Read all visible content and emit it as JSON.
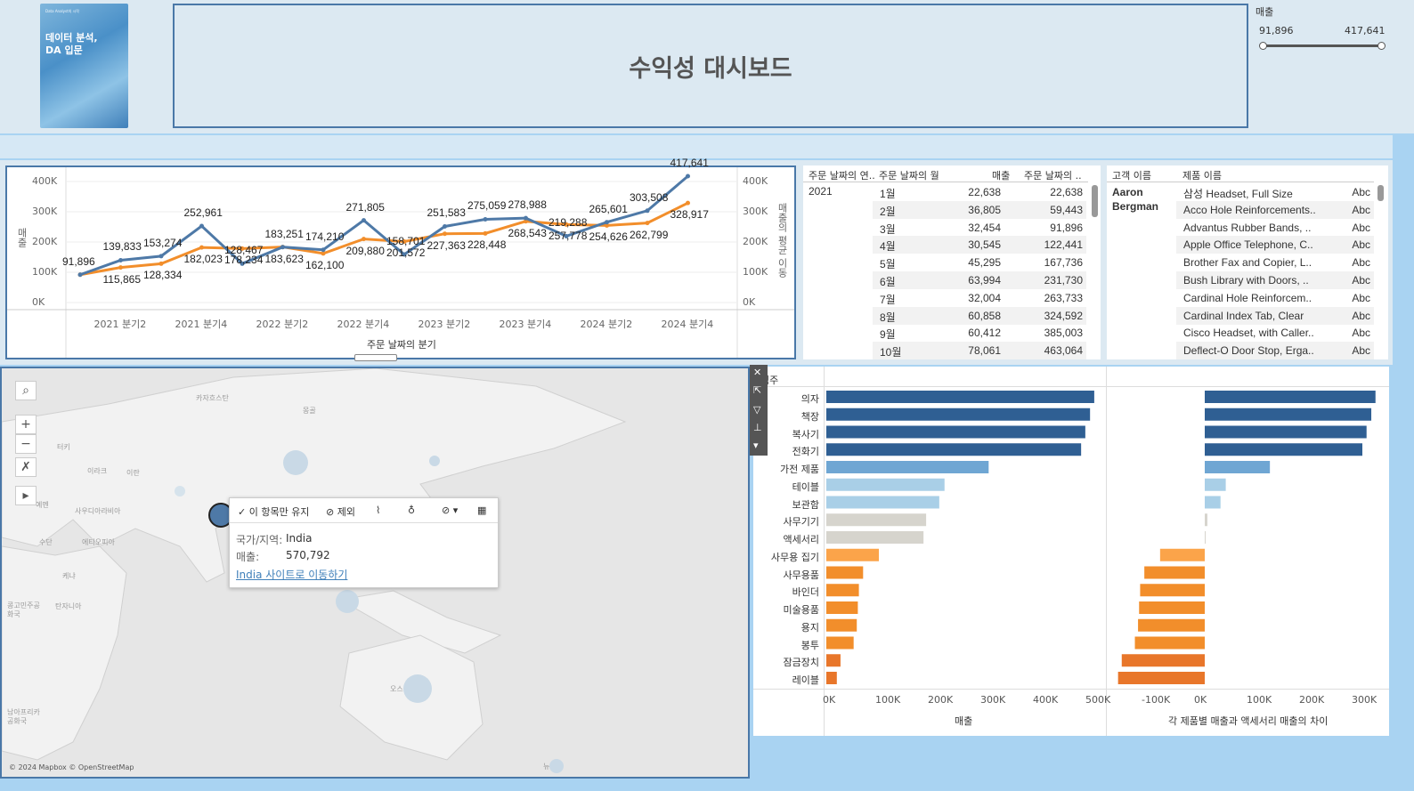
{
  "header": {
    "title": "수익성 대시보드",
    "book_title": "데이터 분석,\nDA 입문",
    "book_subtitle": "Data Analyst의 시작",
    "slider": {
      "label": "매출",
      "min": "91,896",
      "max": "417,641"
    }
  },
  "line_chart": {
    "y_left_label": "매출",
    "y_right_label": "매출의 평균 이동",
    "x_label": "주문 날짜의 분기",
    "y_ticks": [
      "400K",
      "300K",
      "200K",
      "100K",
      "0K"
    ],
    "x_ticks": [
      "2021 분기2",
      "2021 분기4",
      "2022 분기2",
      "2022 분기4",
      "2023 분기2",
      "2023 분기4",
      "2024 분기2",
      "2024 분기4"
    ]
  },
  "chart_data": [
    {
      "type": "line",
      "title": "",
      "xlabel": "주문 날짜의 분기",
      "ylabel": "매출",
      "ylim": [
        0,
        450000
      ],
      "x": [
        "2021 Q1",
        "2021 Q2",
        "2021 Q3",
        "2021 Q4",
        "2022 Q1",
        "2022 Q2",
        "2022 Q3",
        "2022 Q4",
        "2023 Q1",
        "2023 Q2",
        "2023 Q3",
        "2023 Q4",
        "2024 Q1",
        "2024 Q2",
        "2024 Q3",
        "2024 Q4"
      ],
      "series": [
        {
          "name": "매출",
          "color": "#4e79a7",
          "values": [
            91896,
            139833,
            153274,
            252961,
            128467,
            183251,
            174210,
            271805,
            158701,
            251583,
            275059,
            278988,
            219288,
            265601,
            303508,
            417641
          ]
        },
        {
          "name": "매출의 평균 이동",
          "color": "#f28e2b",
          "values": [
            91896,
            115865,
            128334,
            182023,
            178234,
            183623,
            162100,
            209880,
            201572,
            227363,
            228448,
            268543,
            257778,
            254626,
            262799,
            328917
          ]
        }
      ],
      "labels": [
        {
          "t": "91,896",
          "i": 0,
          "s": 0
        },
        {
          "t": "139,833",
          "i": 1,
          "s": 0
        },
        {
          "t": "115,865",
          "i": 1,
          "s": 1
        },
        {
          "t": "128,334",
          "i": 2,
          "s": 1
        },
        {
          "t": "153,274",
          "i": 2,
          "s": 0
        },
        {
          "t": "252,961",
          "i": 3,
          "s": 0
        },
        {
          "t": "182,023",
          "i": 3,
          "s": 1
        },
        {
          "t": "178,234",
          "i": 4,
          "s": 1
        },
        {
          "t": "128,467",
          "i": 4,
          "s": 0
        },
        {
          "t": "183,251",
          "i": 5,
          "s": 0
        },
        {
          "t": "183,623",
          "i": 5,
          "s": 1
        },
        {
          "t": "174,210",
          "i": 6,
          "s": 0
        },
        {
          "t": "162,100",
          "i": 6,
          "s": 1
        },
        {
          "t": "271,805",
          "i": 7,
          "s": 0
        },
        {
          "t": "209,880",
          "i": 7,
          "s": 1
        },
        {
          "t": "201,572",
          "i": 8,
          "s": 1
        },
        {
          "t": "158,701",
          "i": 8,
          "s": 0
        },
        {
          "t": "251,583",
          "i": 9,
          "s": 0
        },
        {
          "t": "227,363",
          "i": 9,
          "s": 1
        },
        {
          "t": "275,059",
          "i": 10,
          "s": 0
        },
        {
          "t": "228,448",
          "i": 10,
          "s": 1
        },
        {
          "t": "278,988",
          "i": 11,
          "s": 0
        },
        {
          "t": "268,543",
          "i": 11,
          "s": 1
        },
        {
          "t": "257,778",
          "i": 12,
          "s": 1
        },
        {
          "t": "219,288",
          "i": 12,
          "s": 0
        },
        {
          "t": "265,601",
          "i": 13,
          "s": 0
        },
        {
          "t": "254,626",
          "i": 13,
          "s": 1
        },
        {
          "t": "303,508",
          "i": 14,
          "s": 0
        },
        {
          "t": "262,799",
          "i": 14,
          "s": 1
        },
        {
          "t": "417,641",
          "i": 15,
          "s": 0
        },
        {
          "t": "328,917",
          "i": 15,
          "s": 1
        }
      ]
    },
    {
      "type": "bar",
      "xlabel": "매출",
      "x_ticks": [
        "0K",
        "100K",
        "200K",
        "300K",
        "400K",
        "500K"
      ],
      "categories": [
        "의자",
        "책장",
        "복사기",
        "전화기",
        "가전 제품",
        "테이블",
        "보관함",
        "사무기기",
        "액세서리",
        "사무용 집기",
        "사무용품",
        "바인더",
        "미술용품",
        "용지",
        "봉투",
        "잠금장치",
        "레이블"
      ],
      "values": [
        510000,
        502000,
        493000,
        485000,
        309000,
        225000,
        215000,
        190000,
        185000,
        100000,
        70000,
        62000,
        60000,
        58000,
        52000,
        27000,
        20000
      ]
    },
    {
      "type": "bar",
      "xlabel": "각 제품별 매출과 액세서리 매출의 차이",
      "x_ticks": [
        "-100K",
        "0K",
        "100K",
        "200K",
        "300K"
      ],
      "categories": [
        "의자",
        "책장",
        "복사기",
        "전화기",
        "가전 제품",
        "테이블",
        "보관함",
        "사무기기",
        "액세서리",
        "사무용 집기",
        "사무용품",
        "바인더",
        "미술용품",
        "용지",
        "봉투",
        "잠금장치",
        "레이블"
      ],
      "values": [
        325000,
        317000,
        308000,
        300000,
        124000,
        40000,
        30000,
        5000,
        0,
        -85000,
        -115000,
        -123000,
        -125000,
        -127000,
        -133000,
        -158000,
        -165000
      ]
    }
  ],
  "bar_chart": {
    "header": "범주",
    "legend": {
      "dark": "#2f5f93",
      "mid": "#6fa6d3",
      "light": "#a9cfe7",
      "gray": "#d6d4cd",
      "orange_light": "#fba44a",
      "orange": "#f28e2b",
      "orange_dark": "#e8762a"
    }
  },
  "table1": {
    "headers": [
      "주문 날짜의 연..",
      "주문 날짜의 월",
      "매출",
      "주문 날짜의 .."
    ],
    "year": "2021",
    "rows": [
      [
        "1월",
        "22,638",
        "22,638"
      ],
      [
        "2월",
        "36,805",
        "59,443"
      ],
      [
        "3월",
        "32,454",
        "91,896"
      ],
      [
        "4월",
        "30,545",
        "122,441"
      ],
      [
        "5월",
        "45,295",
        "167,736"
      ],
      [
        "6월",
        "63,994",
        "231,730"
      ],
      [
        "7월",
        "32,004",
        "263,733"
      ],
      [
        "8월",
        "60,858",
        "324,592"
      ],
      [
        "9월",
        "60,412",
        "385,003"
      ],
      [
        "10월",
        "78,061",
        "463,064"
      ]
    ]
  },
  "table2": {
    "headers": [
      "고객 이름",
      "제품 이름"
    ],
    "customer": "Aaron Bergman",
    "rows": [
      [
        "삼성 Headset, Full Size",
        "Abc"
      ],
      [
        "Acco Hole Reinforcements..",
        "Abc"
      ],
      [
        "Advantus Rubber Bands, ..",
        "Abc"
      ],
      [
        "Apple Office Telephone, C..",
        "Abc"
      ],
      [
        "Brother Fax and Copier, L..",
        "Abc"
      ],
      [
        "Bush Library with Doors, ..",
        "Abc"
      ],
      [
        "Cardinal Hole Reinforcem..",
        "Abc"
      ],
      [
        "Cardinal Index Tab, Clear",
        "Abc"
      ],
      [
        "Cisco Headset, with Caller..",
        "Abc"
      ],
      [
        "Deflect-O Door Stop, Erga..",
        "Abc"
      ]
    ]
  },
  "map": {
    "labels": [
      "카자흐스탄",
      "몽골",
      "터키",
      "이라크",
      "이란",
      "예멘",
      "사우디아라비아",
      "수단",
      "에티오피아",
      "케냐",
      "탄자니아",
      "콩고민주공화국",
      "남아프리카 공화국",
      "오스",
      "뉴"
    ],
    "attribution": "© 2024 Mapbox © OpenStreetMap",
    "tooltip": {
      "keep": "이 항목만 유지",
      "exclude": "제외",
      "country_label": "국가/지역:",
      "country_value": "India",
      "sales_label": "매출:",
      "sales_value": "570,792",
      "link": "India 사이트로 이동하기"
    }
  }
}
